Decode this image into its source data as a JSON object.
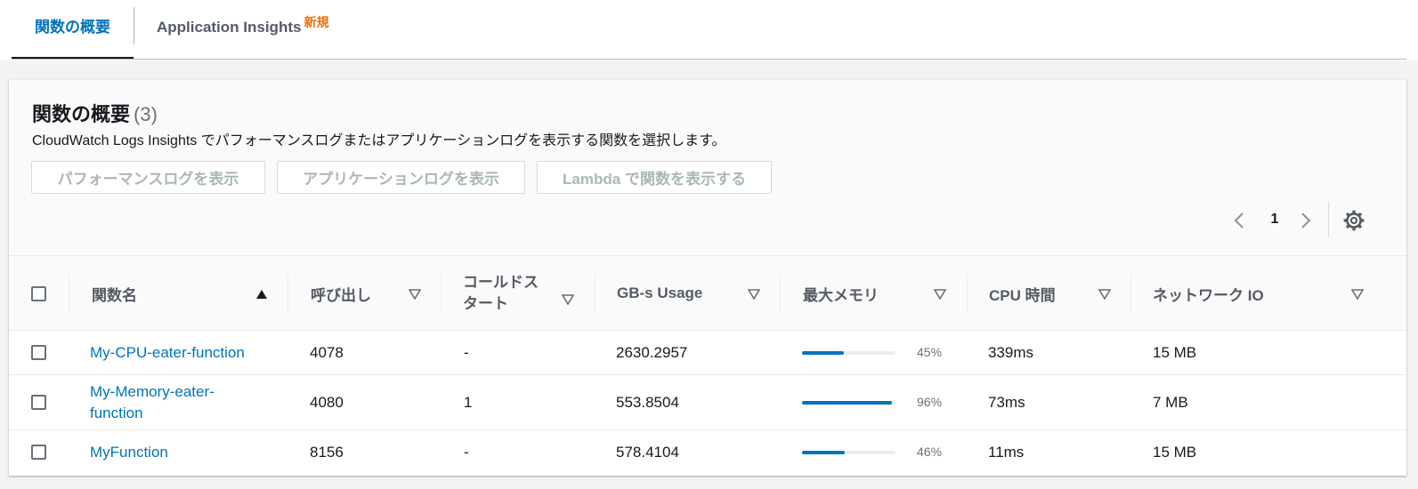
{
  "tabs": [
    {
      "label": "関数の概要"
    },
    {
      "label": "Application Insights",
      "badge": "新規"
    }
  ],
  "panel": {
    "title": "関数の概要",
    "count": "(3)",
    "description": "CloudWatch Logs Insights でパフォーマンスログまたはアプリケーションログを表示する関数を選択します。",
    "buttons": [
      "パフォーマンスログを表示",
      "アプリケーションログを表示",
      "Lambda で関数を表示する"
    ],
    "page": "1"
  },
  "table": {
    "columns": [
      "関数名",
      "呼び出し",
      "コールドスタート",
      "GB-s Usage",
      "最大メモリ",
      "CPU 時間",
      "ネットワーク IO"
    ],
    "rows": [
      {
        "name": "My-CPU-eater-function",
        "invocations": "4078",
        "cold_starts": "-",
        "gbs": "2630.2957",
        "max_memory": 0.45,
        "max_memory_label": "45%",
        "cpu": "339ms",
        "network": "15 MB"
      },
      {
        "name": "My-Memory-eater-function",
        "invocations": "4080",
        "cold_starts": "1",
        "gbs": "553.8504",
        "max_memory": 0.96,
        "max_memory_label": "96%",
        "cpu": "73ms",
        "network": "7 MB"
      },
      {
        "name": "MyFunction",
        "invocations": "8156",
        "cold_starts": "-",
        "gbs": "578.4104",
        "max_memory": 0.46,
        "max_memory_label": "46%",
        "cpu": "11ms",
        "network": "15 MB"
      }
    ]
  },
  "colors": {
    "accent": "#0073bb",
    "badge": "#ec7211"
  }
}
